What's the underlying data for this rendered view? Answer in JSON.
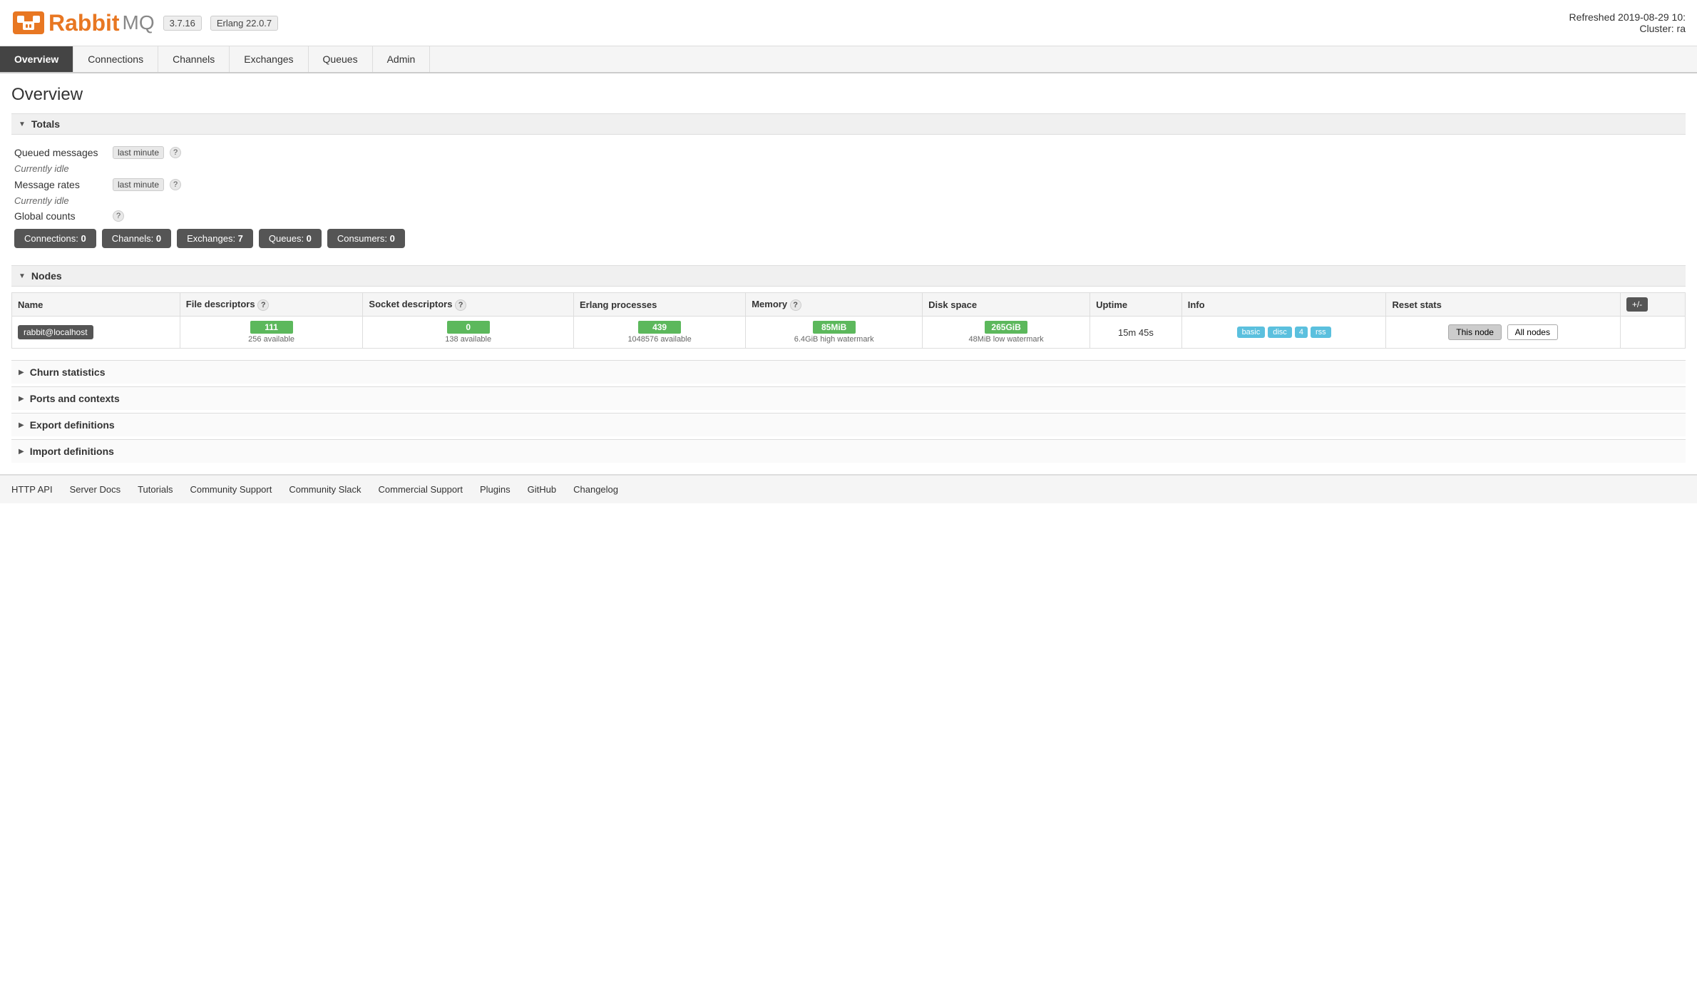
{
  "header": {
    "refresh_text": "Refreshed 2019-08-29 10:",
    "cluster_text": "Cluster: ra",
    "version": "3.7.16",
    "erlang": "Erlang 22.0.7"
  },
  "nav": {
    "items": [
      {
        "id": "overview",
        "label": "Overview",
        "active": true
      },
      {
        "id": "connections",
        "label": "Connections",
        "active": false
      },
      {
        "id": "channels",
        "label": "Channels",
        "active": false
      },
      {
        "id": "exchanges",
        "label": "Exchanges",
        "active": false
      },
      {
        "id": "queues",
        "label": "Queues",
        "active": false
      },
      {
        "id": "admin",
        "label": "Admin",
        "active": false
      }
    ]
  },
  "page": {
    "title": "Overview"
  },
  "totals": {
    "section_title": "Totals",
    "queued_messages_label": "Queued messages",
    "time_filter": "last minute",
    "help": "?",
    "idle1": "Currently idle",
    "message_rates_label": "Message rates",
    "idle2": "Currently idle",
    "global_counts_label": "Global counts",
    "counts": [
      {
        "label": "Connections:",
        "value": "0"
      },
      {
        "label": "Channels:",
        "value": "0"
      },
      {
        "label": "Exchanges:",
        "value": "7"
      },
      {
        "label": "Queues:",
        "value": "0"
      },
      {
        "label": "Consumers:",
        "value": "0"
      }
    ]
  },
  "nodes": {
    "section_title": "Nodes",
    "columns": [
      "Name",
      "File descriptors",
      "?",
      "Socket descriptors",
      "?",
      "Erlang processes",
      "Memory",
      "?",
      "Disk space",
      "Uptime",
      "Info",
      "Reset stats",
      "+/-"
    ],
    "col_headers": [
      "Name",
      "File descriptors",
      "Socket descriptors",
      "Erlang processes",
      "Memory",
      "Disk space",
      "Uptime",
      "Info",
      "Reset stats"
    ],
    "rows": [
      {
        "name": "rabbit@localhost",
        "file_desc_value": "111",
        "file_desc_available": "256 available",
        "socket_desc_value": "0",
        "socket_desc_available": "138 available",
        "erlang_value": "439",
        "erlang_available": "1048576 available",
        "memory_value": "85MiB",
        "memory_watermark": "6.4GiB high watermark",
        "disk_value": "265GiB",
        "disk_watermark": "48MiB low watermark",
        "uptime": "15m 45s",
        "info_basic": "basic",
        "info_disc": "disc",
        "info_num": "4",
        "info_rss": "rss",
        "btn_this": "This node",
        "btn_all": "All nodes"
      }
    ],
    "plus_minus": "+/-"
  },
  "sections": [
    {
      "id": "churn",
      "title": "Churn statistics"
    },
    {
      "id": "ports",
      "title": "Ports and contexts"
    },
    {
      "id": "export",
      "title": "Export definitions"
    },
    {
      "id": "import",
      "title": "Import definitions"
    }
  ],
  "footer": {
    "links": [
      {
        "id": "http-api",
        "label": "HTTP API"
      },
      {
        "id": "server-docs",
        "label": "Server Docs"
      },
      {
        "id": "tutorials",
        "label": "Tutorials"
      },
      {
        "id": "community-support",
        "label": "Community Support"
      },
      {
        "id": "community-slack",
        "label": "Community Slack"
      },
      {
        "id": "commercial-support",
        "label": "Commercial Support"
      },
      {
        "id": "plugins",
        "label": "Plugins"
      },
      {
        "id": "github",
        "label": "GitHub"
      },
      {
        "id": "changelog",
        "label": "Changelog"
      }
    ]
  }
}
